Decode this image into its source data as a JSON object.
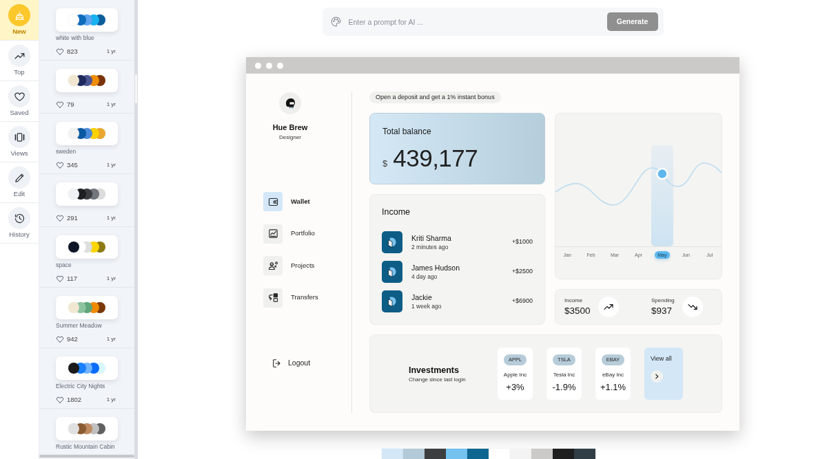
{
  "rail": [
    {
      "label": "New",
      "selected": true
    },
    {
      "label": "Top",
      "selected": false
    },
    {
      "label": "Saved",
      "selected": false
    },
    {
      "label": "Views",
      "selected": false
    },
    {
      "label": "Edit",
      "selected": false
    },
    {
      "label": "History",
      "selected": false
    }
  ],
  "palettes": [
    {
      "swatches": [
        {
          "color": "#ffffff"
        },
        {
          "color": "#0f6cbd"
        },
        {
          "color": "#5ea3ee"
        },
        {
          "color": "#17b3f2"
        },
        {
          "color": "#0b5e99"
        }
      ],
      "name": "white with blue",
      "likes": "823",
      "age": "1 yr"
    },
    {
      "swatches": [
        {
          "color": "#f1e7d0"
        },
        {
          "color": "#1d2a5c"
        },
        {
          "color": "#4b5591"
        },
        {
          "color": "#f08c00"
        },
        {
          "color": "#7a3208"
        }
      ],
      "likes": "79",
      "age": "1 yr"
    },
    {
      "swatches": [
        {
          "color": "#f2f2f2"
        },
        {
          "color": "#0a5aa2"
        },
        {
          "color": "#4a8ad8"
        },
        {
          "color": "#fdd100"
        },
        {
          "color": "#e8a72e"
        }
      ],
      "name": "sweden",
      "likes": "345",
      "age": "1 yr"
    },
    {
      "swatches": [
        {
          "color": "#eef2f6"
        },
        {
          "color": "#1e1f23"
        },
        {
          "color": "#3a3d42"
        },
        {
          "color": "#70767c"
        },
        {
          "color": "#dcdcdc"
        }
      ],
      "likes": "291",
      "age": "1 yr"
    },
    {
      "swatches": [
        {
          "color": "#0e1628"
        },
        {
          "color": "#ffffff"
        },
        {
          "color": "#dedede"
        },
        {
          "color": "#ffd500"
        },
        {
          "color": "#8c7a12"
        }
      ],
      "name": "space",
      "likes": "117",
      "age": "1 yr"
    },
    {
      "swatches": [
        {
          "color": "#f2e8d2"
        },
        {
          "color": "#8cc4a0"
        },
        {
          "color": "#5fa67c"
        },
        {
          "color": "#f08a00"
        },
        {
          "color": "#7a3808"
        }
      ],
      "name": "Summer Meadow",
      "likes": "942",
      "age": "1 yr"
    },
    {
      "swatches": [
        {
          "color": "#1a1a1a"
        },
        {
          "color": "#1a80ff"
        },
        {
          "color": "#70b4ff"
        },
        {
          "color": "#0a6cff"
        },
        {
          "color": "#d8f8ff"
        }
      ],
      "name": "Electric City Nights",
      "likes": "1802",
      "age": "1 yr"
    },
    {
      "swatches": [
        {
          "color": "#e0e0e0"
        },
        {
          "color": "#8a5a30"
        },
        {
          "color": "#c08a60"
        },
        {
          "color": "#c0c0c0"
        },
        {
          "color": "#606060"
        }
      ],
      "name": "Rustic Mountain Cabin"
    }
  ],
  "prompt": {
    "placeholder": "Enter a prompt for AI ...",
    "button": "Generate"
  },
  "profile": {
    "name": "Hue Brew",
    "role": "Designer"
  },
  "menu": [
    {
      "label": "Wallet",
      "selected": true
    },
    {
      "label": "Portfolio",
      "selected": false
    },
    {
      "label": "Projects",
      "selected": false
    },
    {
      "label": "Transfers",
      "selected": false
    }
  ],
  "logout": "Logout",
  "promo": "Open a deposit and get a 1% instant bonus",
  "balance": {
    "title": "Total balance",
    "currency": "$",
    "amount": "439,177"
  },
  "income": {
    "title": "Income",
    "rows": [
      {
        "name": "Kriti Sharma",
        "time": "2 minutes ago",
        "amount": "+$1000"
      },
      {
        "name": "James Hudson",
        "time": "4 day ago",
        "amount": "+$2500"
      },
      {
        "name": "Jackie",
        "time": "1 week ago",
        "amount": "+$6900"
      }
    ]
  },
  "chart": {
    "months": [
      {
        "label": "Jan",
        "selected": false
      },
      {
        "label": "Feb",
        "selected": false
      },
      {
        "label": "Mar",
        "selected": false
      },
      {
        "label": "Apr",
        "selected": false
      },
      {
        "label": "May",
        "selected": true
      },
      {
        "label": "Jun",
        "selected": false
      },
      {
        "label": "Jul",
        "selected": false
      }
    ]
  },
  "stats": [
    {
      "kind": "rising",
      "label": "Income",
      "value": "$3500"
    },
    {
      "kind": "falling",
      "label": "Spending",
      "value": "$937"
    }
  ],
  "investments": {
    "title": "Investments",
    "subtitle": "Change since last login",
    "stocks": [
      {
        "ticker": "APPL",
        "company": "Apple Inc",
        "change": "+3%"
      },
      {
        "ticker": "TSLA",
        "company": "Tesla Inc",
        "change": "-1.9%"
      },
      {
        "ticker": "EBAY",
        "company": "eBay Inc",
        "change": "+1.1%"
      }
    ],
    "view_all": "View all"
  },
  "color_strip": [
    {
      "color": "#d3e7f6"
    },
    {
      "color": "#b3cbd8"
    },
    {
      "color": "#3d3e40"
    },
    {
      "color": "#73c2f0"
    },
    {
      "color": "#0d6690"
    },
    {
      "color": "#ffffff"
    },
    {
      "color": "#f3f3f3"
    },
    {
      "color": "#cbcac8"
    },
    {
      "color": "#1f1f1f"
    },
    {
      "color": "#323e45"
    }
  ]
}
